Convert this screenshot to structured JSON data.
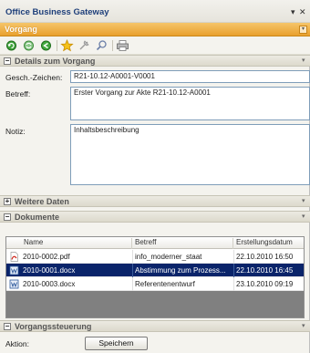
{
  "window": {
    "title": "Office Business Gateway",
    "pin_glyph": "▾",
    "close_glyph": "✕"
  },
  "vorgang_bar": {
    "label": "Vorgang",
    "dropdown_glyph": "▾"
  },
  "toolbar": {
    "icons": [
      "refresh-icon",
      "sync-icon",
      "back-arrow-icon",
      "star-icon",
      "unpin-icon",
      "search-icon",
      "printer-icon"
    ]
  },
  "details": {
    "header": "Details zum Vorgang",
    "toggle": "−",
    "fields": {
      "zeichen_label": "Gesch.-Zeichen:",
      "zeichen_value": "R21-10.12-A0001-V0001",
      "betreff_label": "Betreff:",
      "betreff_value": "Erster Vorgang zur Akte R21-10.12-A0001",
      "notiz_label": "Notiz:",
      "notiz_value": "Inhaltsbeschreibung"
    }
  },
  "weitere": {
    "header": "Weitere Daten",
    "toggle": "+"
  },
  "dokumente": {
    "header": "Dokumente",
    "toggle": "−",
    "columns": [
      "Name",
      "Betreff",
      "Erstellungsdatum"
    ],
    "rows": [
      {
        "name": "2010-0002.pdf",
        "betreff": "info_moderner_staat",
        "datum": "22.10.2010 16:50",
        "type": "pdf",
        "selected": false
      },
      {
        "name": "2010-0001.docx",
        "betreff": "Abstimmung zum Prozess...",
        "datum": "22.10.2010 16:45",
        "type": "docx",
        "selected": true
      },
      {
        "name": "2010-0003.docx",
        "betreff": "Referentenentwurf",
        "datum": "23.10.2010 09:19",
        "type": "docx",
        "selected": false
      }
    ]
  },
  "steuerung": {
    "header": "Vorgangssteuerung",
    "toggle": "−",
    "aktion_label": "Aktion:",
    "save_label": "Speichern"
  },
  "colors": {
    "accent_orange": "#e9a02e",
    "title_blue": "#1e3f7a",
    "selection_navy": "#0a246a"
  }
}
